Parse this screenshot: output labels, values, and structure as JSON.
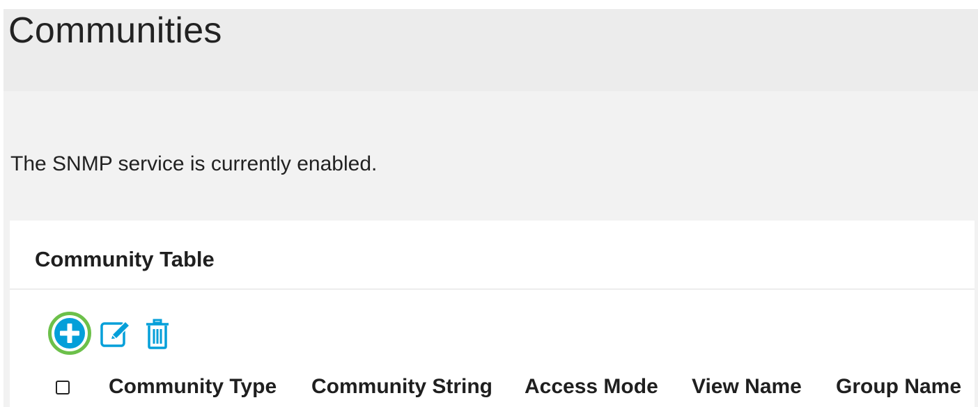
{
  "page": {
    "title": "Communities",
    "status_text": "The SNMP service is currently enabled."
  },
  "community_table": {
    "title": "Community Table",
    "toolbar": {
      "add_icon": "plus-circle-icon",
      "edit_icon": "edit-icon",
      "delete_icon": "trash-icon"
    },
    "columns": [
      "Community Type",
      "Community String",
      "Access Mode",
      "View Name",
      "Group Name"
    ]
  },
  "colors": {
    "accent_blue": "#049fd9",
    "highlight_green": "#6cc04a",
    "header_band": "#ececec",
    "content_band": "#f2f2f2"
  }
}
